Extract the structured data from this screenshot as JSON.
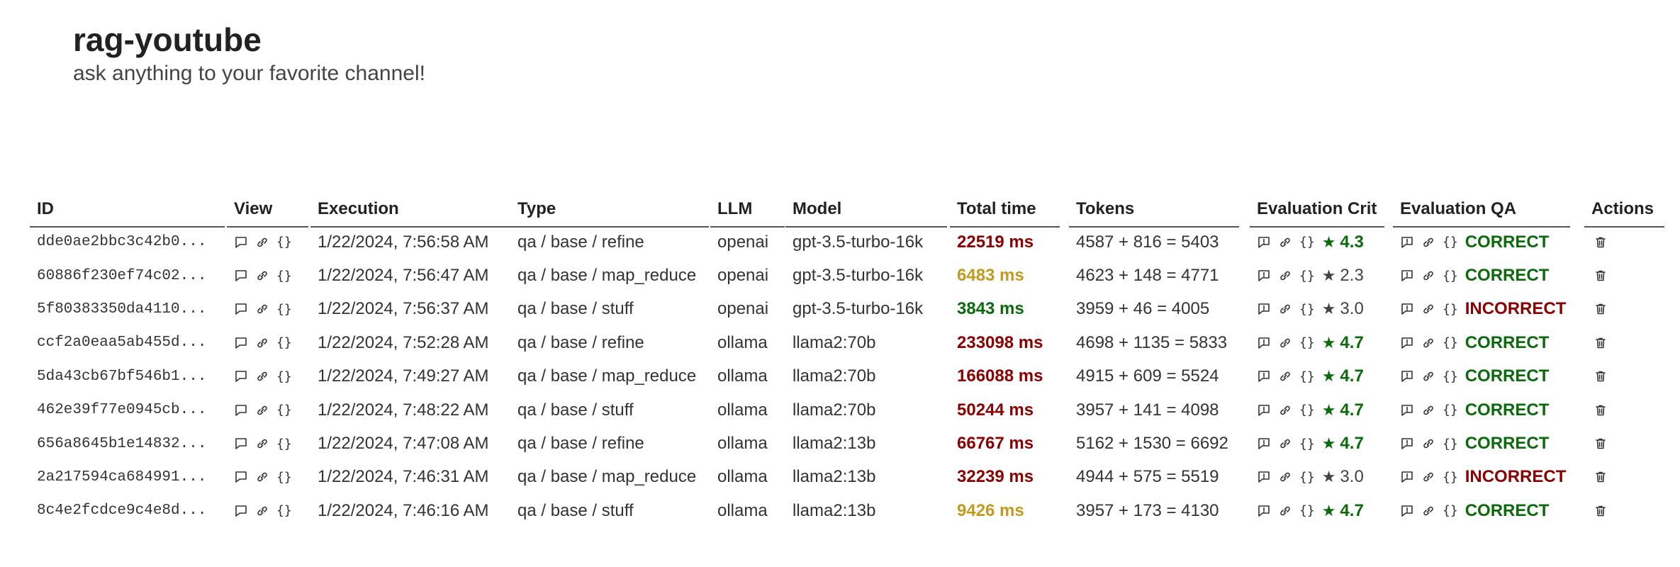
{
  "app": {
    "title": "rag-youtube",
    "subtitle": "ask anything to your favorite channel!"
  },
  "colors": {
    "red": "#8b0000",
    "orange": "#c49a1e",
    "green": "#0b6b0b",
    "gray": "#444444"
  },
  "table": {
    "headers": {
      "id": "ID",
      "view": "View",
      "execution": "Execution",
      "type": "Type",
      "llm": "LLM",
      "model": "Model",
      "total_time": "Total time",
      "tokens": "Tokens",
      "eval_crit": "Evaluation Crit",
      "eval_qa": "Evaluation QA",
      "actions": "Actions"
    },
    "icons": {
      "view": [
        "comment-icon",
        "link-icon",
        "json-icon"
      ],
      "eval": [
        "feedback-icon",
        "link-icon",
        "json-icon"
      ],
      "actions": [
        "trash-icon"
      ]
    },
    "rows": [
      {
        "id": "dde0ae2bbc3c42b0...",
        "execution": "1/22/2024, 7:56:58 AM",
        "type": "qa / base / refine",
        "llm": "openai",
        "model": "gpt-3.5-turbo-16k",
        "total_time": "22519 ms",
        "time_color": "red",
        "tokens": "4587 + 816 = 5403",
        "crit_score": "4.3",
        "crit_color": "green",
        "qa": "CORRECT",
        "qa_color": "green"
      },
      {
        "id": "60886f230ef74c02...",
        "execution": "1/22/2024, 7:56:47 AM",
        "type": "qa / base / map_reduce",
        "llm": "openai",
        "model": "gpt-3.5-turbo-16k",
        "total_time": "6483 ms",
        "time_color": "orange",
        "tokens": "4623 + 148 = 4771",
        "crit_score": "2.3",
        "crit_color": "gray",
        "qa": "CORRECT",
        "qa_color": "green"
      },
      {
        "id": "5f80383350da4110...",
        "execution": "1/22/2024, 7:56:37 AM",
        "type": "qa / base / stuff",
        "llm": "openai",
        "model": "gpt-3.5-turbo-16k",
        "total_time": "3843 ms",
        "time_color": "green",
        "tokens": "3959 + 46 = 4005",
        "crit_score": "3.0",
        "crit_color": "gray",
        "qa": "INCORRECT",
        "qa_color": "red"
      },
      {
        "id": "ccf2a0eaa5ab455d...",
        "execution": "1/22/2024, 7:52:28 AM",
        "type": "qa / base / refine",
        "llm": "ollama",
        "model": "llama2:70b",
        "total_time": "233098 ms",
        "time_color": "red",
        "tokens": "4698 + 1135 = 5833",
        "crit_score": "4.7",
        "crit_color": "green",
        "qa": "CORRECT",
        "qa_color": "green"
      },
      {
        "id": "5da43cb67bf546b1...",
        "execution": "1/22/2024, 7:49:27 AM",
        "type": "qa / base / map_reduce",
        "llm": "ollama",
        "model": "llama2:70b",
        "total_time": "166088 ms",
        "time_color": "red",
        "tokens": "4915 + 609 = 5524",
        "crit_score": "4.7",
        "crit_color": "green",
        "qa": "CORRECT",
        "qa_color": "green"
      },
      {
        "id": "462e39f77e0945cb...",
        "execution": "1/22/2024, 7:48:22 AM",
        "type": "qa / base / stuff",
        "llm": "ollama",
        "model": "llama2:70b",
        "total_time": "50244 ms",
        "time_color": "red",
        "tokens": "3957 + 141 = 4098",
        "crit_score": "4.7",
        "crit_color": "green",
        "qa": "CORRECT",
        "qa_color": "green"
      },
      {
        "id": "656a8645b1e14832...",
        "execution": "1/22/2024, 7:47:08 AM",
        "type": "qa / base / refine",
        "llm": "ollama",
        "model": "llama2:13b",
        "total_time": "66767 ms",
        "time_color": "red",
        "tokens": "5162 + 1530 = 6692",
        "crit_score": "4.7",
        "crit_color": "green",
        "qa": "CORRECT",
        "qa_color": "green"
      },
      {
        "id": "2a217594ca684991...",
        "execution": "1/22/2024, 7:46:31 AM",
        "type": "qa / base / map_reduce",
        "llm": "ollama",
        "model": "llama2:13b",
        "total_time": "32239 ms",
        "time_color": "red",
        "tokens": "4944 + 575 = 5519",
        "crit_score": "3.0",
        "crit_color": "gray",
        "qa": "INCORRECT",
        "qa_color": "red"
      },
      {
        "id": "8c4e2fcdce9c4e8d...",
        "execution": "1/22/2024, 7:46:16 AM",
        "type": "qa / base / stuff",
        "llm": "ollama",
        "model": "llama2:13b",
        "total_time": "9426 ms",
        "time_color": "orange",
        "tokens": "3957 + 173 = 4130",
        "crit_score": "4.7",
        "crit_color": "green",
        "qa": "CORRECT",
        "qa_color": "green"
      }
    ]
  }
}
